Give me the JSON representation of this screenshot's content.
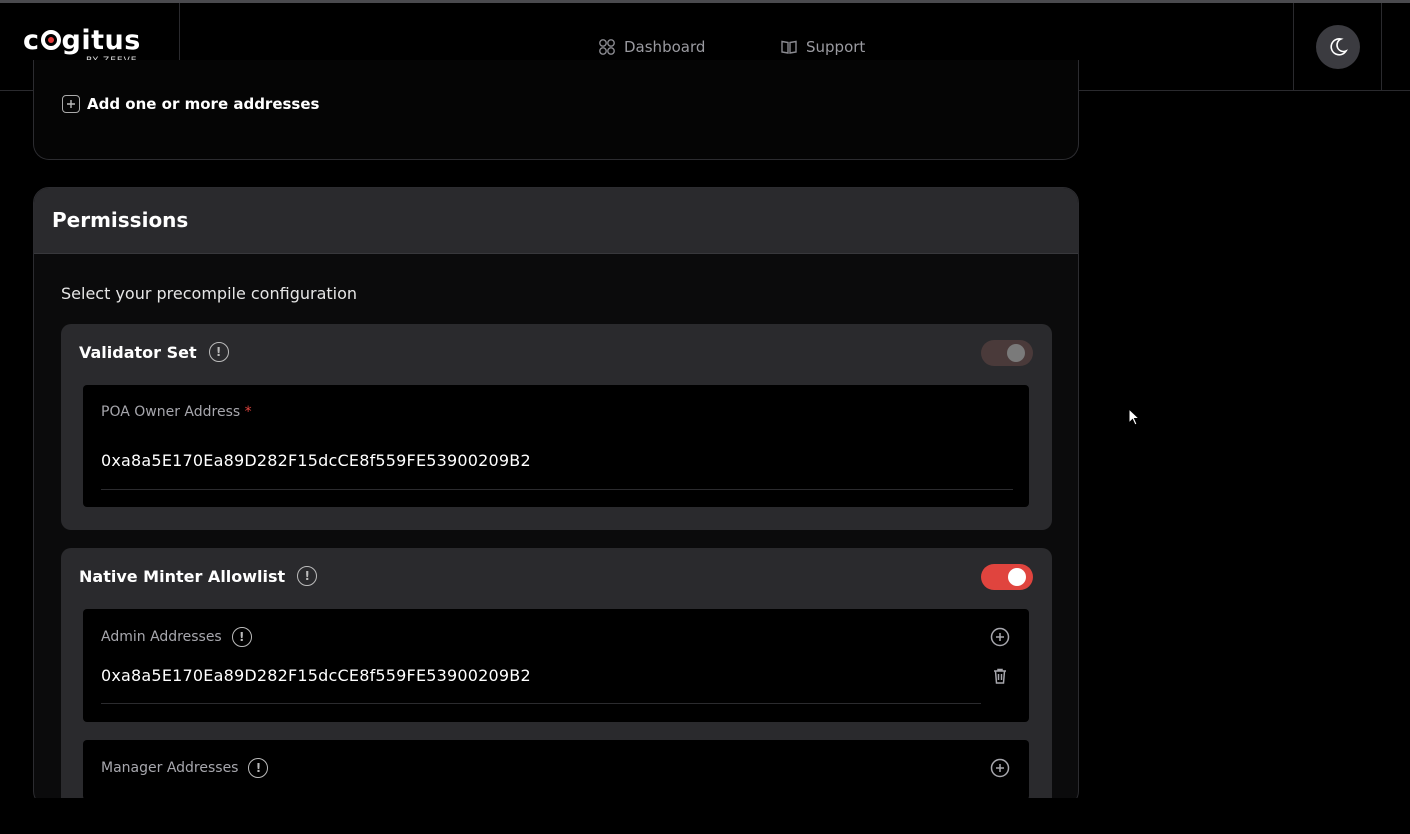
{
  "header": {
    "logo_text_pre": "c",
    "logo_text_post": "gitus",
    "logo_sub": "BY ZEEVE",
    "nav": [
      {
        "label": "Dashboard",
        "icon": "grid-icon"
      },
      {
        "label": "Support",
        "icon": "book-icon"
      }
    ],
    "theme_icon": "moon-icon"
  },
  "prev_card": {
    "add_label": "Add one or more addresses"
  },
  "permissions": {
    "title": "Permissions",
    "subtitle": "Select your precompile configuration",
    "validator_set": {
      "title": "Validator Set",
      "enabled": false,
      "field_label": "POA Owner Address",
      "required_mark": "*",
      "value": "0xa8a5E170Ea89D282F15dcCE8f559FE53900209B2"
    },
    "native_minter": {
      "title": "Native Minter Allowlist",
      "enabled": true,
      "admin_label": "Admin Addresses",
      "admin_value": "0xa8a5E170Ea89D282F15dcCE8f559FE53900209B2",
      "manager_label": "Manager Addresses"
    }
  },
  "colors": {
    "accent": "#e0443e",
    "card_bg": "#2a2a2d",
    "page_bg": "#000000"
  }
}
